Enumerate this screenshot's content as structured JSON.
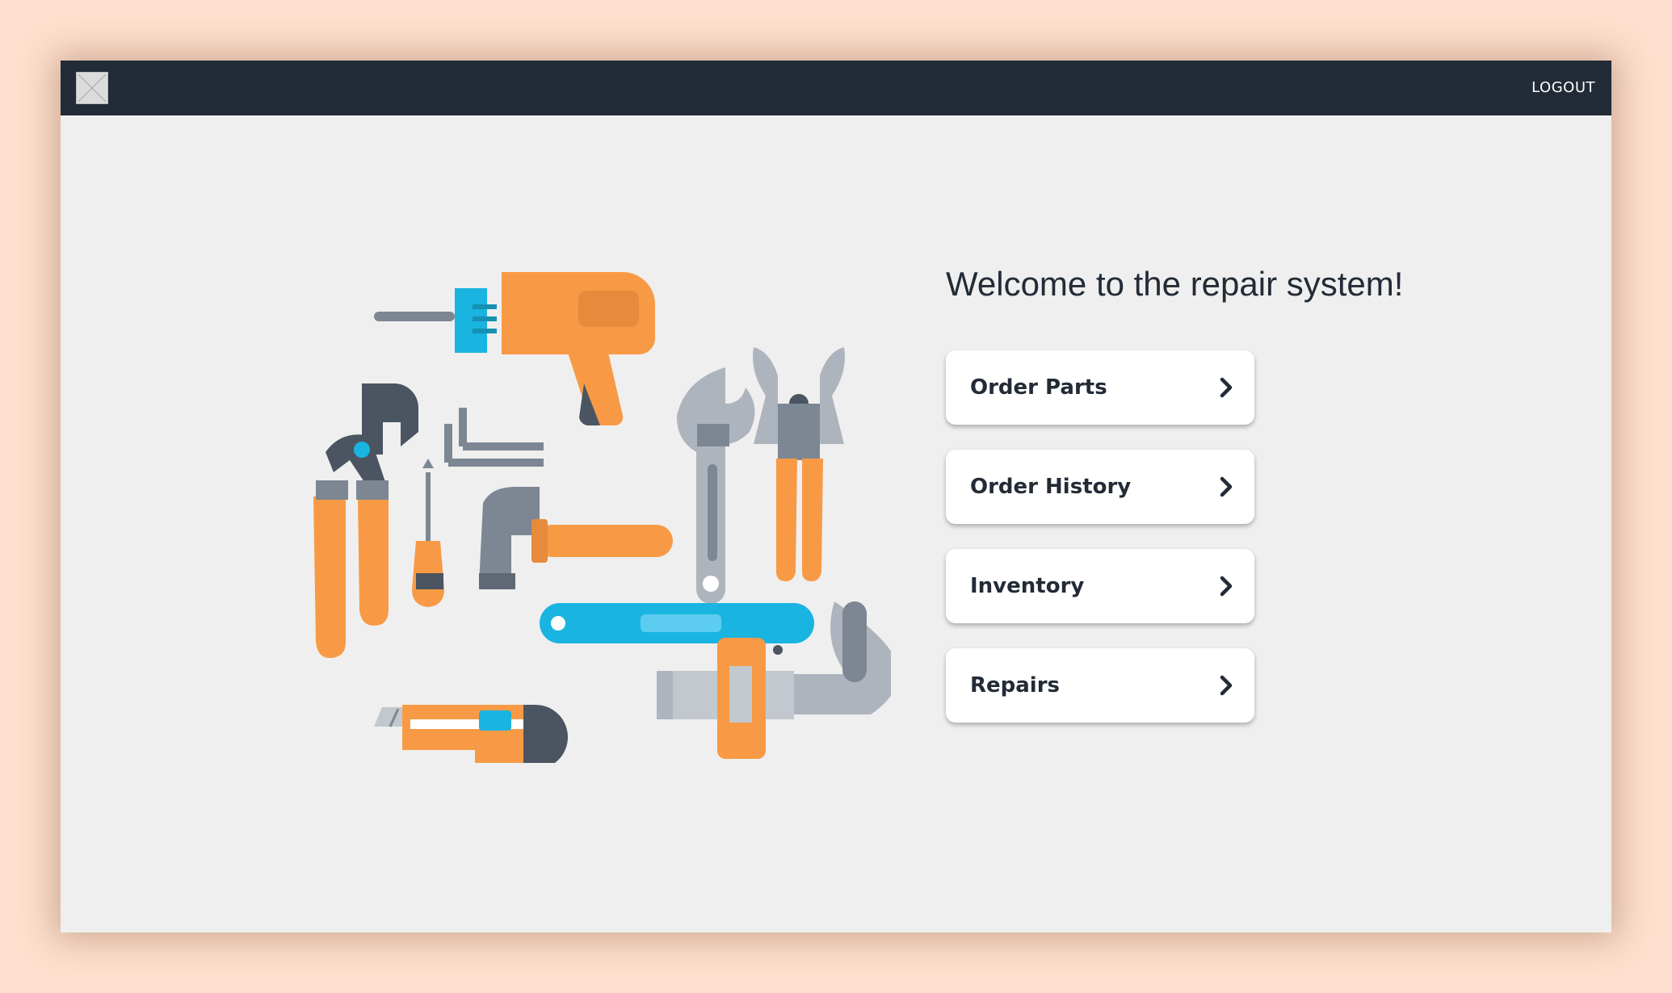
{
  "header": {
    "logout_label": "LOGOUT",
    "logo_icon": "broken-image-placeholder"
  },
  "main": {
    "title": "Welcome to the repair system!",
    "menu": [
      {
        "label": "Order Parts",
        "icon": "chevron-right-icon"
      },
      {
        "label": "Order History",
        "icon": "chevron-right-icon"
      },
      {
        "label": "Inventory",
        "icon": "chevron-right-icon"
      },
      {
        "label": "Repairs",
        "icon": "chevron-right-icon"
      }
    ]
  },
  "colors": {
    "page_background": "#fde0cd",
    "topbar": "#222b36",
    "content_background": "#efefef",
    "card_background": "#ffffff",
    "text_dark": "#222b36",
    "accent_orange": "#f89a45",
    "accent_blue": "#1ab4e0",
    "tool_gray": "#7d8793"
  }
}
